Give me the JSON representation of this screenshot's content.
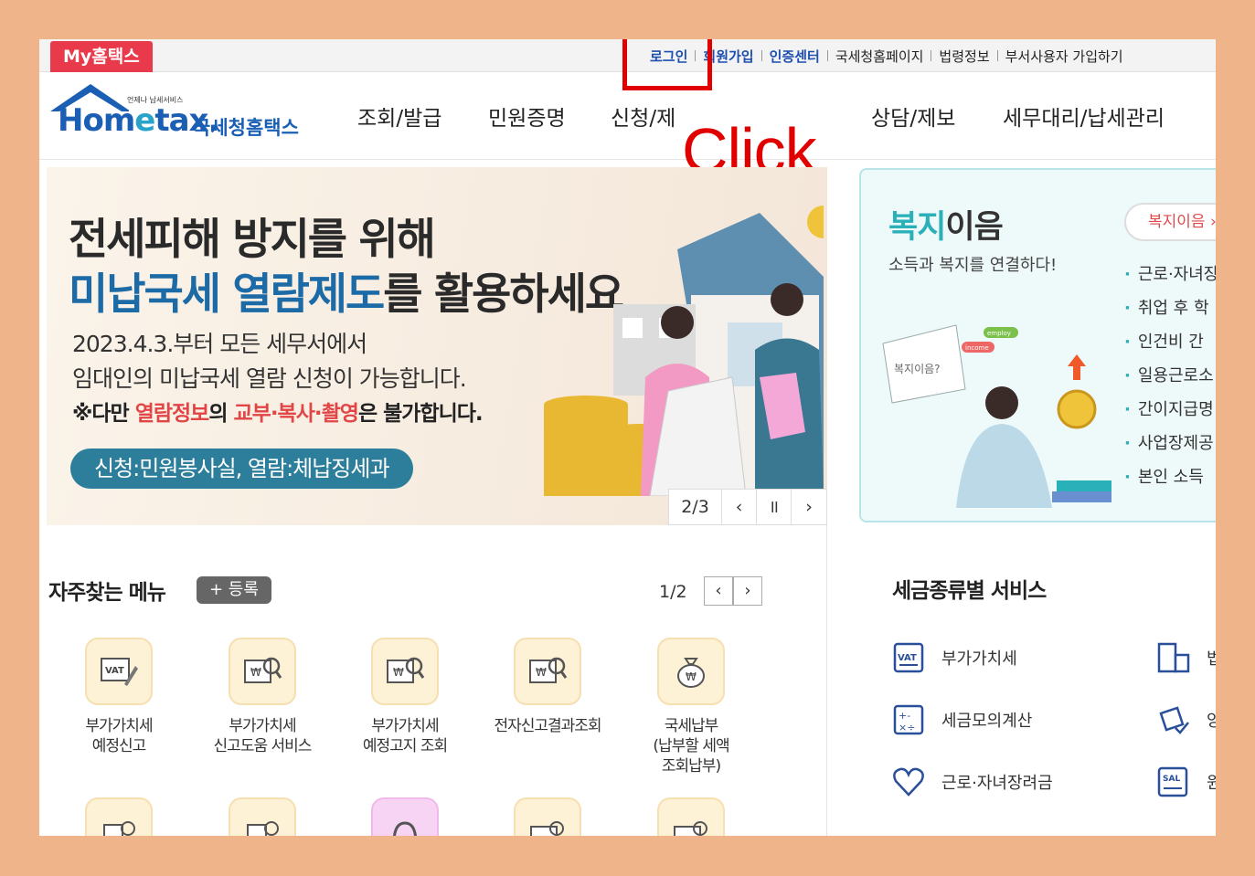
{
  "topbar": {
    "my_hometax": "My홈택스",
    "links": [
      "로그인",
      "회원가입",
      "인증센터",
      "국세청홈페이지",
      "법령정보",
      "부서사용자 가입하기"
    ]
  },
  "header": {
    "logo_small": "언제나 납세서비스",
    "logo_home": "Hom",
    "logo_e": "e",
    "logo_tax": "tax.",
    "logo_kr": "국세청홈택스",
    "nav": [
      "조회/발급",
      "민원증명",
      "신청/제",
      "상담/제보",
      "세무대리/납세관리"
    ]
  },
  "annotation": {
    "click": "Click"
  },
  "banner": {
    "title1": "전세피해 방지를 위해",
    "title2_hl": "미납국세 열람제도",
    "title2_rest": "를 활용하세요",
    "line1": "2023.4.3.부터 모든 세무서에서",
    "line2": "임대인의 미납국세 열람 신청이 가능합니다.",
    "line3_a": "※다만 ",
    "line3_b": "열람정보",
    "line3_c": "의 ",
    "line3_d": "교부·복사·촬영",
    "line3_e": "은 불가합니다.",
    "pill": "신청:민원봉사실, 열람:체납징세과",
    "counter": "2/3",
    "prev": "‹",
    "pause": "॥",
    "next": "›"
  },
  "welfare": {
    "title_a": "복지",
    "title_b": "이음",
    "subtitle": "소득과 복지를 연결하다!",
    "button": "복지이음 ›",
    "items": [
      "근로·자녀장",
      "취업 후 학",
      "인건비 간",
      "일용근로소",
      "간이지급명",
      "사업장제공",
      "본인 소득"
    ],
    "bubble": "복지이음?",
    "tag1": "employ",
    "tag2": "income"
  },
  "frequent": {
    "title": "자주찾는 메뉴",
    "register": "+ 등록",
    "pager": "1/2",
    "prev": "‹",
    "next": "›",
    "items": [
      {
        "label": "부가가치세\n예정신고",
        "icon": "vat-edit-icon"
      },
      {
        "label": "부가가치세\n신고도움 서비스",
        "icon": "won-search-icon"
      },
      {
        "label": "부가가치세\n예정고지 조회",
        "icon": "won-search-icon"
      },
      {
        "label": "전자신고결과조회",
        "icon": "won-search-icon"
      },
      {
        "label": "국세납부\n(납부할 세액\n조회납부)",
        "icon": "money-bag-icon"
      }
    ]
  },
  "tax_service": {
    "title": "세금종류별 서비스",
    "left": [
      "부가가치세",
      "세금모의계산",
      "근로·자녀장려금"
    ],
    "right_glyphs": [
      "법",
      "양",
      "원"
    ]
  }
}
